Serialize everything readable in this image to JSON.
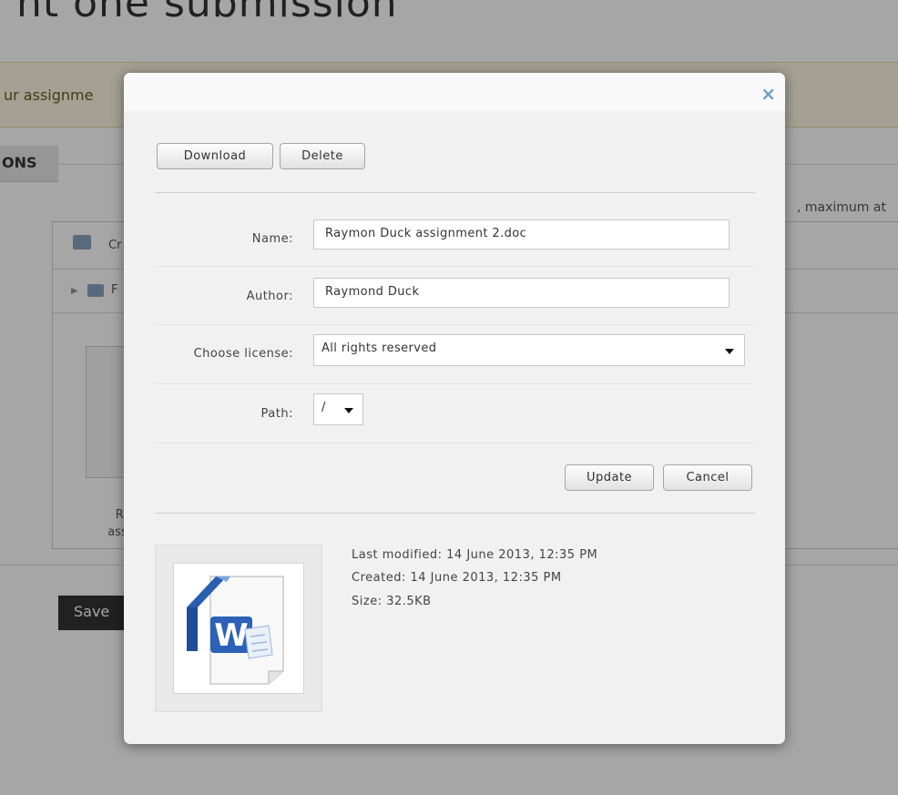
{
  "background": {
    "page_title": "nt one submission",
    "notice_text": "ur assignme",
    "section_tab": "ONS",
    "max_attachments_text": ", maximum at",
    "toolbar_label": "Cr",
    "path_label": "F",
    "file_name_line1": "Ray",
    "file_name_line2": "assign",
    "save_button": "Save"
  },
  "dialog": {
    "close_icon": "×",
    "buttons": {
      "download": "Download",
      "delete": "Delete",
      "update": "Update",
      "cancel": "Cancel"
    },
    "fields": {
      "name_label": "Name:",
      "name_value": "Raymon Duck assignment 2.doc",
      "author_label": "Author:",
      "author_value": "Raymond Duck",
      "license_label": "Choose license:",
      "license_value": "All rights reserved",
      "path_label": "Path:",
      "path_value": "/"
    },
    "file_info": {
      "last_modified": "Last modified: 14 June 2013, 12:35 PM",
      "created": "Created: 14 June 2013, 12:35 PM",
      "size": "Size: 32.5KB"
    },
    "preview_icon": "word-document-icon"
  },
  "colors": {
    "overlay": "rgba(0,0,0,0.35)",
    "dialog_bg": "#f1f1f1",
    "close_icon": "#6f9ec7",
    "word_blue": "#2a5fb0"
  }
}
